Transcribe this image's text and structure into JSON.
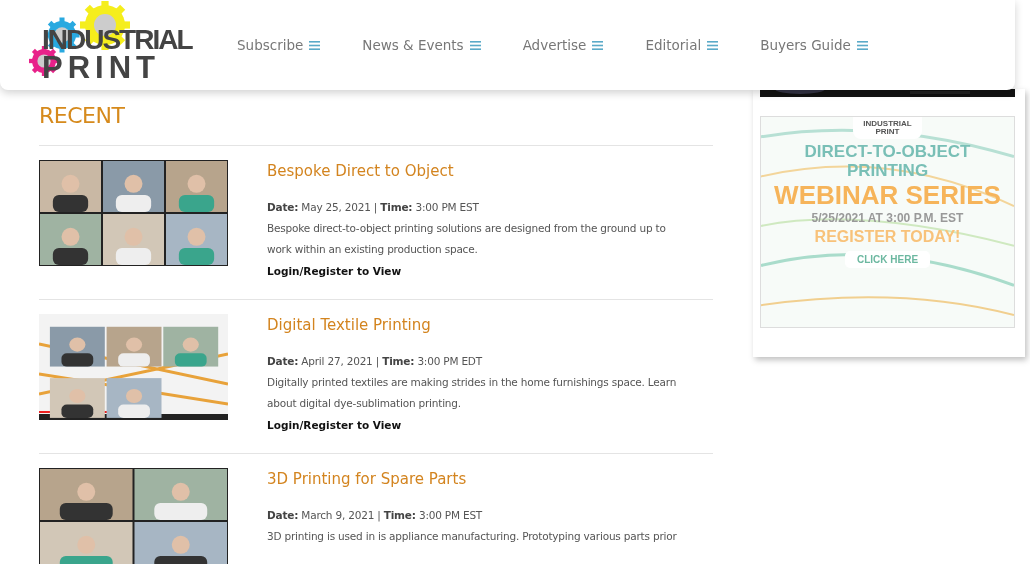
{
  "logo": {
    "line_1": "INDUSTRIAL",
    "line_2": "PRINT"
  },
  "nav": [
    {
      "label": "Subscribe"
    },
    {
      "label": "News & Events"
    },
    {
      "label": "Advertise"
    },
    {
      "label": "Editorial"
    },
    {
      "label": "Buyers Guide"
    }
  ],
  "section_title": "RECENT",
  "articles": [
    {
      "title": "Bespoke Direct to Object",
      "date_label": "Date:",
      "date": "May 25, 2021",
      "separator": "|",
      "time_label": "Time:",
      "time": "3:00 PM EST",
      "summary": "Bespoke direct-to-object printing solutions are designed from the ground up to work within an existing production space.",
      "link": "Login/Register to View"
    },
    {
      "title": "Digital Textile Printing",
      "date_label": "Date:",
      "date": "April 27, 2021",
      "separator": "|",
      "time_label": "Time:",
      "time": "3:00 PM EDT",
      "summary": "Digitally printed textiles are making strides in the home furnishings space. Learn about digital dye-sublimation printing.",
      "link": "Login/Register to View"
    },
    {
      "title": "3D Printing for Spare Parts",
      "date_label": "Date:",
      "date": "March 9, 2021",
      "separator": "|",
      "time_label": "Time:",
      "time": "3:00 PM EST",
      "summary": "3D printing is used in is appliance manufacturing. Prototyping various parts prior"
    }
  ],
  "ad": {
    "logo_line_1": "INDUSTRIAL",
    "logo_line_2": "PRINT",
    "headline": "DIRECT-TO-OBJECT PRINTING",
    "series": "WEBINAR SERIES",
    "date": "5/25/2021 AT 3:00 P.M. EST",
    "cta": "REGISTER TODAY!",
    "button": "CLICK HERE"
  }
}
